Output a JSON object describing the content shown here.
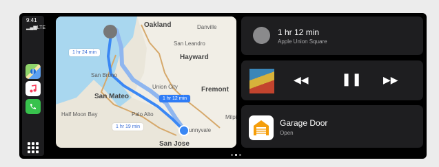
{
  "status": {
    "time": "9:41",
    "network": "LTE"
  },
  "dock": {
    "apps": [
      {
        "name": "Maps",
        "icon": "maps-icon"
      },
      {
        "name": "Music",
        "icon": "music-icon"
      },
      {
        "name": "Phone",
        "icon": "phone-icon"
      }
    ]
  },
  "map": {
    "places": [
      "Oakland",
      "Danville",
      "San Leandro",
      "Hayward",
      "San Bruno",
      "San Mateo",
      "Union City",
      "Fremont",
      "Half Moon Bay",
      "Palo Alto",
      "Milpi",
      "unnyvale",
      "San Jose"
    ],
    "eta_tags": [
      "1 hr 24 min",
      "1 hr 12 min",
      "1 hr 19 min"
    ]
  },
  "nav_card": {
    "title": "1 hr 12 min",
    "subtitle": "Apple Union Square"
  },
  "media_card": {
    "controls": [
      "rewind",
      "pause",
      "fast-forward"
    ]
  },
  "home_card": {
    "title": "Garage Door",
    "subtitle": "Open"
  },
  "pager": {
    "pages": 3,
    "active": 2
  }
}
